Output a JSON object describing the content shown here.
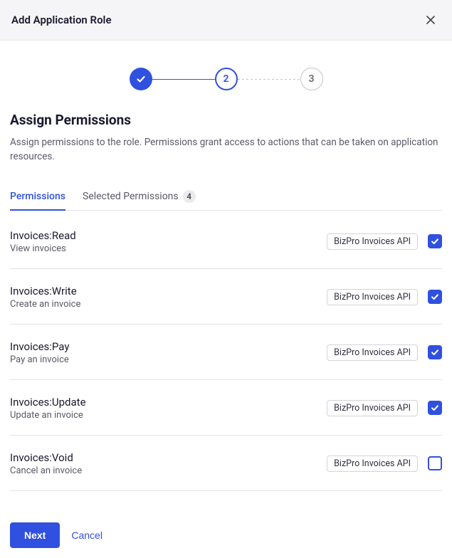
{
  "header": {
    "title": "Add Application Role"
  },
  "stepper": {
    "step1": {
      "label": "✓"
    },
    "step2": {
      "label": "2"
    },
    "step3": {
      "label": "3"
    }
  },
  "section": {
    "title": "Assign Permissions",
    "description": "Assign permissions to the role. Permissions grant access to actions that can be taken on application resources."
  },
  "tabs": {
    "permissions": {
      "label": "Permissions"
    },
    "selected": {
      "label": "Selected Permissions",
      "count": "4"
    }
  },
  "permissions": [
    {
      "name": "Invoices:Read",
      "desc": "View invoices",
      "api": "BizPro Invoices API",
      "checked": true
    },
    {
      "name": "Invoices:Write",
      "desc": "Create an invoice",
      "api": "BizPro Invoices API",
      "checked": true
    },
    {
      "name": "Invoices:Pay",
      "desc": "Pay an invoice",
      "api": "BizPro Invoices API",
      "checked": true
    },
    {
      "name": "Invoices:Update",
      "desc": "Update an invoice",
      "api": "BizPro Invoices API",
      "checked": true
    },
    {
      "name": "Invoices:Void",
      "desc": "Cancel an invoice",
      "api": "BizPro Invoices API",
      "checked": false
    }
  ],
  "footer": {
    "next": "Next",
    "cancel": "Cancel"
  }
}
